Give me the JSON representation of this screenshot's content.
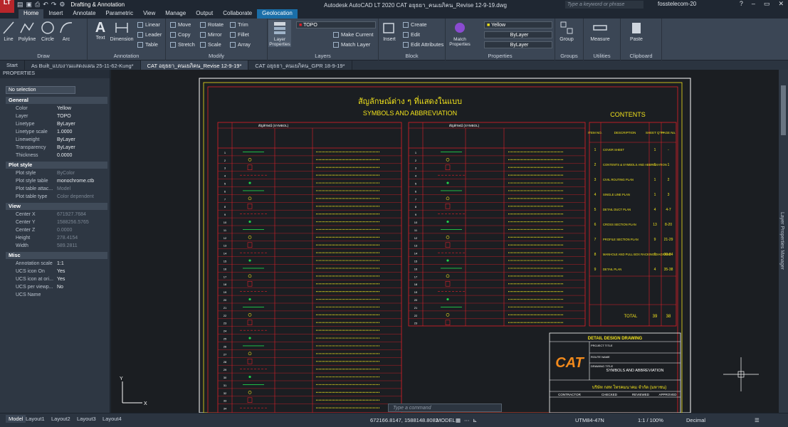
{
  "titlebar": {
    "workspace": "Drafting & Annotation",
    "doc_title": "Autodesk AutoCAD LT 2020   CAT อยุธยา_คนเยภิคน_Revise 12-9-19.dwg",
    "search": "Type a keyword or phrase",
    "user": "fosstelecom-20",
    "logo": "LT"
  },
  "ribbon_tabs": [
    "Home",
    "Insert",
    "Annotate",
    "Parametric",
    "View",
    "Manage",
    "Output",
    "Collaborate",
    "Geolocation"
  ],
  "ribbon": {
    "draw": {
      "title": "Draw",
      "line": "Line",
      "polyline": "Polyline",
      "circle": "Circle",
      "arc": "Arc"
    },
    "annotation": {
      "title": "Annotation",
      "text": "Text",
      "dimension": "Dimension",
      "linear": "Linear",
      "leader": "Leader",
      "table": "Table"
    },
    "modify": {
      "title": "Modify",
      "move": "Move",
      "rotate": "Rotate",
      "trim": "Trim",
      "copy": "Copy",
      "mirror": "Mirror",
      "fillet": "Fillet",
      "stretch": "Stretch",
      "scale": "Scale",
      "array": "Array"
    },
    "layers": {
      "title": "Layers",
      "layer_properties": "Layer Properties",
      "current_layer": "TOPO",
      "make_current": "Make Current",
      "match_layer": "Match Layer"
    },
    "block": {
      "title": "Block",
      "insert": "Insert",
      "create": "Create",
      "edit": "Edit",
      "edit_attributes": "Edit Attributes"
    },
    "properties": {
      "title": "Properties",
      "match_properties": "Match Properties",
      "color": "Yellow",
      "linetype": "ByLayer",
      "lineweight": "ByLayer"
    },
    "groups": {
      "title": "Groups",
      "group": "Group"
    },
    "utilities": {
      "title": "Utilities",
      "measure": "Measure"
    },
    "clipboard": {
      "title": "Clipboard",
      "paste": "Paste"
    }
  },
  "doc_tabs": [
    "Start",
    "As Built_แบบงานแสดงแผน 25-11-62-Kung*",
    "CAT อยุธยา_คนเยภิคน_Revise 12-9-19*",
    "CAT อยุธยา_คนเยภิคน_GPR 18-9-19*"
  ],
  "properties_panel": {
    "header": "PROPERTIES",
    "selection": "No selection",
    "general": {
      "title": "General",
      "rows": [
        [
          "Color",
          "Yellow"
        ],
        [
          "Layer",
          "TOPO"
        ],
        [
          "Linetype",
          "ByLayer"
        ],
        [
          "Linetype scale",
          "1.0000"
        ],
        [
          "Lineweight",
          "ByLayer"
        ],
        [
          "Transparency",
          "ByLayer"
        ],
        [
          "Thickness",
          "0.0000"
        ]
      ]
    },
    "plot": {
      "title": "Plot style",
      "rows": [
        [
          "Plot style",
          "ByColor"
        ],
        [
          "Plot style table",
          "monochrome.ctb"
        ],
        [
          "Plot table attac...",
          "Model"
        ],
        [
          "Plot table type",
          "Color dependent"
        ]
      ]
    },
    "view": {
      "title": "View",
      "rows": [
        [
          "Center X",
          "671927.7684"
        ],
        [
          "Center Y",
          "1588256.5765"
        ],
        [
          "Center Z",
          "0.0000"
        ],
        [
          "Height",
          "278.4154"
        ],
        [
          "Width",
          "589.2811"
        ]
      ]
    },
    "misc": {
      "title": "Misc",
      "rows": [
        [
          "Annotation scale",
          "1:1"
        ],
        [
          "UCS icon On",
          "Yes"
        ],
        [
          "UCS icon at ori...",
          "Yes"
        ],
        [
          "UCS per viewp...",
          "No"
        ],
        [
          "UCS Name",
          ""
        ]
      ]
    }
  },
  "drawing": {
    "title_th": "สัญลักษณ์ต่าง ๆ ที่แสดงในแบบ",
    "title_en": "SYMBOLS AND ABBREVIATION",
    "contents_title": "CONTENTS",
    "contents_header": [
      "ITEM NO.",
      "DESCRIPTION",
      "SHEET Q'TY",
      "PAGE No."
    ],
    "contents_rows": [
      [
        "1",
        "COVER SHEET",
        "1",
        "-"
      ],
      [
        "2",
        "CONTENTS & SYMBOLS AND ABBREVIATION",
        "1",
        "1"
      ],
      [
        "3",
        "CIVIL ROUTING PLAN",
        "1",
        "2"
      ],
      [
        "4",
        "SINGLE LINE PLAN",
        "1",
        "3"
      ],
      [
        "5",
        "DETAIL DUCT PLAN",
        "4",
        "4-7"
      ],
      [
        "6",
        "CROSS SECTION PLAN",
        "13",
        "8-20"
      ],
      [
        "7",
        "PROFILE SECTION PLAN",
        "9",
        "21-29"
      ],
      [
        "8",
        "MANHOLE AND PULL BOX RACKING DIAGRAME",
        "6",
        "30-34"
      ],
      [
        "9",
        "DETAIL PLAN",
        "4",
        "35-38"
      ]
    ],
    "total_label": "TOTAL",
    "total_sheets": "39",
    "total_pages": "38",
    "legend_header": "สัญลักษณ์ (SYMBOL)",
    "tb_title": "DETAIL DESIGN DRAWING",
    "tb_logo": "CAT",
    "tb_drawing": "SYMBOLS AND ABBREVIATION",
    "tb_company": "บริษัท กสท โทรคมนาคม จำกัด (มหาชน)",
    "tb_contractor": "CONTRACTOR",
    "tb_checked": "CHECKED",
    "tb_reviewed": "REVIEWED",
    "tb_approved": "APPROVED",
    "tb_project_title": "PROJECT TITLE",
    "tb_route_name": "ROUTE NAME",
    "tb_drawing_title": "DRAWING TITLE"
  },
  "status": {
    "layouts": [
      "Model",
      "Layout1",
      "Layout2",
      "Layout3",
      "Layout4"
    ],
    "coords": "672166.8147, 1588148.8082",
    "mode": "MODEL",
    "scale": "1:1 / 100%",
    "units": "Decimal",
    "cs": "UTM84-47N",
    "cmd_placeholder": "Type a command",
    "side_label": "Layer Properties Manager"
  },
  "colors": {
    "accent": "#1a6ea8",
    "drawing_red": "#e0202a",
    "drawing_yellow": "#f2e31c",
    "drawing_white": "#ffffff",
    "canvas": "#1b1e22"
  }
}
